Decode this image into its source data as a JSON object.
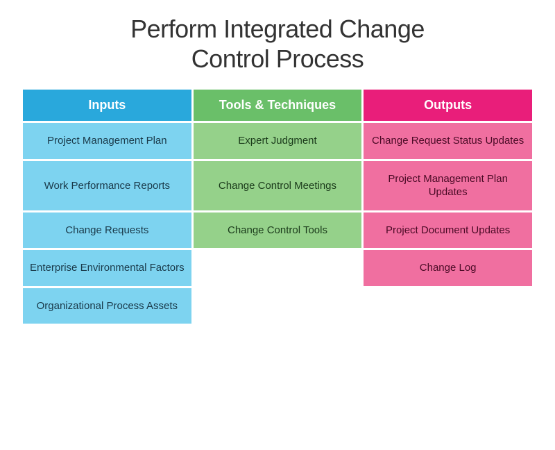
{
  "title": {
    "line1": "Perform Integrated Change",
    "line2": "Control Process"
  },
  "headers": {
    "inputs": "Inputs",
    "tools": "Tools & Techniques",
    "outputs": "Outputs"
  },
  "rows": [
    {
      "inputs": "Project Management Plan",
      "tools": "Expert Judgment",
      "outputs": "Change Request Status Updates"
    },
    {
      "inputs": "Work Performance Reports",
      "tools": "Change Control Meetings",
      "outputs": "Project Management Plan Updates"
    },
    {
      "inputs": "Change Requests",
      "tools": "Change Control Tools",
      "outputs": "Project Document Updates"
    },
    {
      "inputs": "Enterprise Environmental Factors",
      "tools": null,
      "outputs": "Change Log"
    },
    {
      "inputs": "Organizational Process Assets",
      "tools": null,
      "outputs": null
    }
  ]
}
